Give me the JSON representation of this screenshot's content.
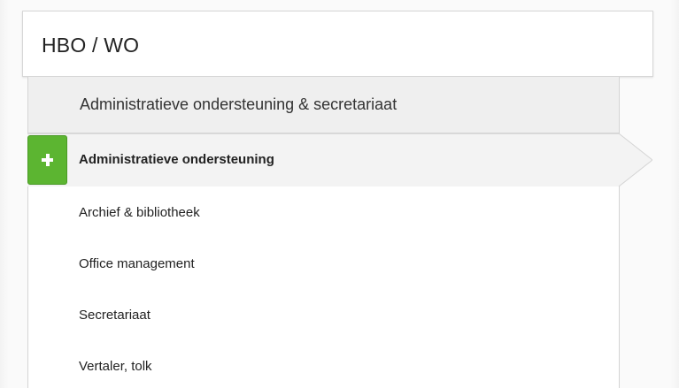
{
  "header": {
    "title": "HBO / WO"
  },
  "category": {
    "label": "Administratieve ondersteuning & secretariaat"
  },
  "active_item": {
    "label": "Administratieve ondersteuning",
    "icon": "plus-icon",
    "accent_color": "#5cb531"
  },
  "items": [
    {
      "label": "Archief & bibliotheek"
    },
    {
      "label": "Office management"
    },
    {
      "label": "Secretariaat"
    },
    {
      "label": "Vertaler, tolk"
    }
  ]
}
